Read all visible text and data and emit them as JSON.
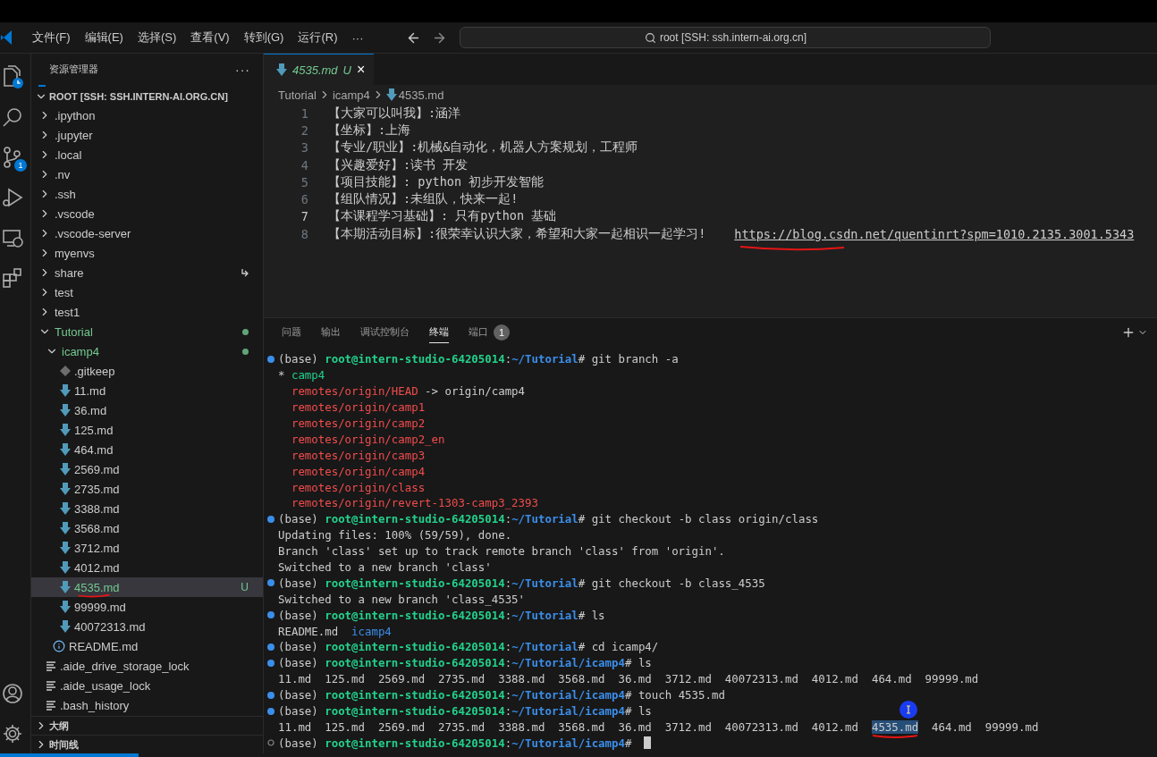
{
  "title_bar": {
    "menus": [
      "文件(F)",
      "编辑(E)",
      "选择(S)",
      "查看(V)",
      "转到(G)",
      "运行(R)"
    ],
    "more": "···",
    "search": "root [SSH: ssh.intern-ai.org.cn]"
  },
  "activity_bar": {
    "items": [
      {
        "kind": "explorer"
      },
      {
        "kind": "search"
      },
      {
        "kind": "source-control",
        "badge": "1"
      },
      {
        "kind": "run"
      },
      {
        "kind": "remote"
      },
      {
        "kind": "extensions"
      }
    ],
    "bottom": [
      {
        "kind": "account"
      },
      {
        "kind": "settings"
      }
    ]
  },
  "sidebar": {
    "title": "资源管理器",
    "more": "···",
    "root": "ROOT [SSH: SSH.INTERN-AI.ORG.CN]",
    "tree": [
      {
        "name": ".ipython",
        "kind": "folder",
        "expanded": false,
        "selected": false
      },
      {
        "name": ".jupyter",
        "kind": "folder",
        "expanded": false,
        "selected": false
      },
      {
        "name": ".local",
        "kind": "folder",
        "expanded": false,
        "selected": false
      },
      {
        "name": ".nv",
        "kind": "folder",
        "expanded": false,
        "selected": false
      },
      {
        "name": ".ssh",
        "kind": "folder",
        "expanded": false,
        "selected": false
      },
      {
        "name": ".vscode",
        "kind": "folder",
        "expanded": false,
        "selected": false
      },
      {
        "name": ".vscode-server",
        "kind": "folder",
        "expanded": false,
        "selected": false
      },
      {
        "name": "myenvs",
        "kind": "folder",
        "expanded": false,
        "selected": false
      },
      {
        "name": "share",
        "kind": "folder",
        "expanded": false,
        "selected": false,
        "symlink": true
      },
      {
        "name": "test",
        "kind": "folder",
        "expanded": false,
        "selected": false
      },
      {
        "name": "test1",
        "kind": "folder",
        "expanded": false,
        "selected": false
      },
      {
        "name": "Tutorial",
        "kind": "folder",
        "expanded": true,
        "selected": false,
        "modified": true,
        "children": [
          {
            "name": "icamp4",
            "kind": "folder",
            "expanded": true,
            "selected": false,
            "modified": true,
            "children": [
              {
                "name": ".gitkeep",
                "kind": "git",
                "selected": false
              },
              {
                "name": "11.md",
                "kind": "md",
                "selected": false
              },
              {
                "name": "36.md",
                "kind": "md",
                "selected": false
              },
              {
                "name": "125.md",
                "kind": "md",
                "selected": false
              },
              {
                "name": "464.md",
                "kind": "md",
                "selected": false
              },
              {
                "name": "2569.md",
                "kind": "md",
                "selected": false
              },
              {
                "name": "2735.md",
                "kind": "md",
                "selected": false
              },
              {
                "name": "3388.md",
                "kind": "md",
                "selected": false
              },
              {
                "name": "3568.md",
                "kind": "md",
                "selected": false
              },
              {
                "name": "3712.md",
                "kind": "md",
                "selected": false
              },
              {
                "name": "4012.md",
                "kind": "md",
                "selected": false
              },
              {
                "name": "4535.md",
                "kind": "md",
                "selected": true,
                "status": "U",
                "marked": true
              },
              {
                "name": "99999.md",
                "kind": "md",
                "selected": false
              },
              {
                "name": "40072313.md",
                "kind": "md",
                "selected": false
              }
            ]
          },
          {
            "name": "README.md",
            "kind": "info",
            "selected": false
          }
        ]
      },
      {
        "name": ".aide_drive_storage_lock",
        "kind": "text",
        "selected": false
      },
      {
        "name": ".aide_usage_lock",
        "kind": "text",
        "selected": false
      },
      {
        "name": ".bash_history",
        "kind": "text",
        "selected": false
      }
    ],
    "sections": [
      {
        "label": "大纲",
        "expanded": false
      },
      {
        "label": "时间线",
        "expanded": false
      }
    ]
  },
  "editor": {
    "tab": {
      "label": "4535.md",
      "status": "U",
      "close": "×"
    },
    "breadcrumb": [
      "Tutorial",
      "icamp4",
      "4535.md"
    ],
    "lines": [
      {
        "number": "1",
        "text": "【大家可以叫我】:涵洋",
        "current": false
      },
      {
        "number": "2",
        "text": "【坐标】:上海",
        "current": false
      },
      {
        "number": "3",
        "text": "【专业/职业】:机械&自动化，机器人方案规划，工程师",
        "current": false
      },
      {
        "number": "4",
        "text": "【兴趣爱好】:读书 开发",
        "current": false
      },
      {
        "number": "5",
        "text": "【项目技能】: python 初步开发智能",
        "current": false
      },
      {
        "number": "6",
        "text": "【组队情况】:未组队，快来一起!",
        "current": false
      },
      {
        "number": "7",
        "text": "【本课程学习基础】: 只有python 基础",
        "current": true
      },
      {
        "number": "8",
        "text": "【本期活动目标】:很荣幸认识大家，希望和大家一起相识一起学习!",
        "current": false,
        "link": "https://blog.csdn.net/quentinrt?spm=1010.2135.3001.5343",
        "marked": true
      }
    ]
  },
  "panel": {
    "tabs": [
      {
        "label": "问题",
        "selected": false
      },
      {
        "label": "输出",
        "selected": false
      },
      {
        "label": "调试控制台",
        "selected": false
      },
      {
        "label": "终端",
        "selected": true
      },
      {
        "label": "端口",
        "selected": false,
        "badge": "1"
      }
    ],
    "terminal": [
      {
        "kind": "prompt",
        "active": false,
        "env": "(base)",
        "user": "root@intern-studio-64205014",
        "sep": ":",
        "path": "~/Tutorial",
        "mark": "#",
        "command": "git branch -a"
      },
      {
        "kind": "output",
        "parts": [
          {
            "text": "* ",
            "kind": "plain"
          },
          {
            "text": "camp4",
            "kind": "current"
          }
        ]
      },
      {
        "kind": "output",
        "parts": [
          {
            "text": "  remotes/origin/HEAD",
            "kind": "remote"
          },
          {
            "text": " -> origin/camp4",
            "kind": "plain"
          }
        ]
      },
      {
        "kind": "output",
        "parts": [
          {
            "text": "  remotes/origin/camp1",
            "kind": "remote"
          }
        ]
      },
      {
        "kind": "output",
        "parts": [
          {
            "text": "  remotes/origin/camp2",
            "kind": "remote"
          }
        ]
      },
      {
        "kind": "output",
        "parts": [
          {
            "text": "  remotes/origin/camp2_en",
            "kind": "remote"
          }
        ]
      },
      {
        "kind": "output",
        "parts": [
          {
            "text": "  remotes/origin/camp3",
            "kind": "remote"
          }
        ]
      },
      {
        "kind": "output",
        "parts": [
          {
            "text": "  remotes/origin/camp4",
            "kind": "remote"
          }
        ]
      },
      {
        "kind": "output",
        "parts": [
          {
            "text": "  remotes/origin/class",
            "kind": "remote"
          }
        ]
      },
      {
        "kind": "output",
        "parts": [
          {
            "text": "  remotes/origin/revert-1303-camp3_2393",
            "kind": "remote"
          }
        ]
      },
      {
        "kind": "prompt",
        "active": false,
        "env": "(base)",
        "user": "root@intern-studio-64205014",
        "sep": ":",
        "path": "~/Tutorial",
        "mark": "#",
        "command": "git checkout -b class origin/class"
      },
      {
        "kind": "output",
        "parts": [
          {
            "text": "Updating files: 100% (59/59), done.",
            "kind": "plain"
          }
        ]
      },
      {
        "kind": "output",
        "parts": [
          {
            "text": "Branch 'class' set up to track remote branch 'class' from 'origin'.",
            "kind": "plain"
          }
        ]
      },
      {
        "kind": "output",
        "parts": [
          {
            "text": "Switched to a new branch 'class'",
            "kind": "plain"
          }
        ]
      },
      {
        "kind": "prompt",
        "active": false,
        "env": "(base)",
        "user": "root@intern-studio-64205014",
        "sep": ":",
        "path": "~/Tutorial",
        "mark": "#",
        "command": "git checkout -b class_4535"
      },
      {
        "kind": "output",
        "parts": [
          {
            "text": "Switched to a new branch 'class_4535'",
            "kind": "plain"
          }
        ]
      },
      {
        "kind": "prompt",
        "active": false,
        "env": "(base)",
        "user": "root@intern-studio-64205014",
        "sep": ":",
        "path": "~/Tutorial",
        "mark": "#",
        "command": "ls"
      },
      {
        "kind": "output",
        "parts": [
          {
            "text": "README.md  ",
            "kind": "plain"
          },
          {
            "text": "icamp4",
            "kind": "dir"
          }
        ]
      },
      {
        "kind": "prompt",
        "active": false,
        "env": "(base)",
        "user": "root@intern-studio-64205014",
        "sep": ":",
        "path": "~/Tutorial",
        "mark": "#",
        "command": "cd icamp4/"
      },
      {
        "kind": "prompt",
        "active": false,
        "env": "(base)",
        "user": "root@intern-studio-64205014",
        "sep": ":",
        "path": "~/Tutorial/icamp4",
        "mark": "#",
        "command": "ls"
      },
      {
        "kind": "output",
        "parts": [
          {
            "text": "11.md  125.md  2569.md  2735.md  3388.md  3568.md  36.md  3712.md  40072313.md  4012.md  464.md  99999.md",
            "kind": "plain"
          }
        ]
      },
      {
        "kind": "prompt",
        "active": false,
        "env": "(base)",
        "user": "root@intern-studio-64205014",
        "sep": ":",
        "path": "~/Tutorial/icamp4",
        "mark": "#",
        "command": "touch 4535.md"
      },
      {
        "kind": "prompt",
        "active": false,
        "env": "(base)",
        "user": "root@intern-studio-64205014",
        "sep": ":",
        "path": "~/Tutorial/icamp4",
        "mark": "#",
        "command": "ls"
      },
      {
        "kind": "output",
        "parts": [
          {
            "text": "11.md  125.md  2569.md  2735.md  3388.md  3568.md  36.md  3712.md  40072313.md  4012.md  ",
            "kind": "plain"
          },
          {
            "text": "4535.md",
            "kind": "selected",
            "marked": true
          },
          {
            "text": "  464.md  99999.md",
            "kind": "plain"
          }
        ]
      },
      {
        "kind": "prompt",
        "active": true,
        "env": "(base)",
        "user": "root@intern-studio-64205014",
        "sep": ":",
        "path": "~/Tutorial/icamp4",
        "mark": "#"
      }
    ]
  }
}
